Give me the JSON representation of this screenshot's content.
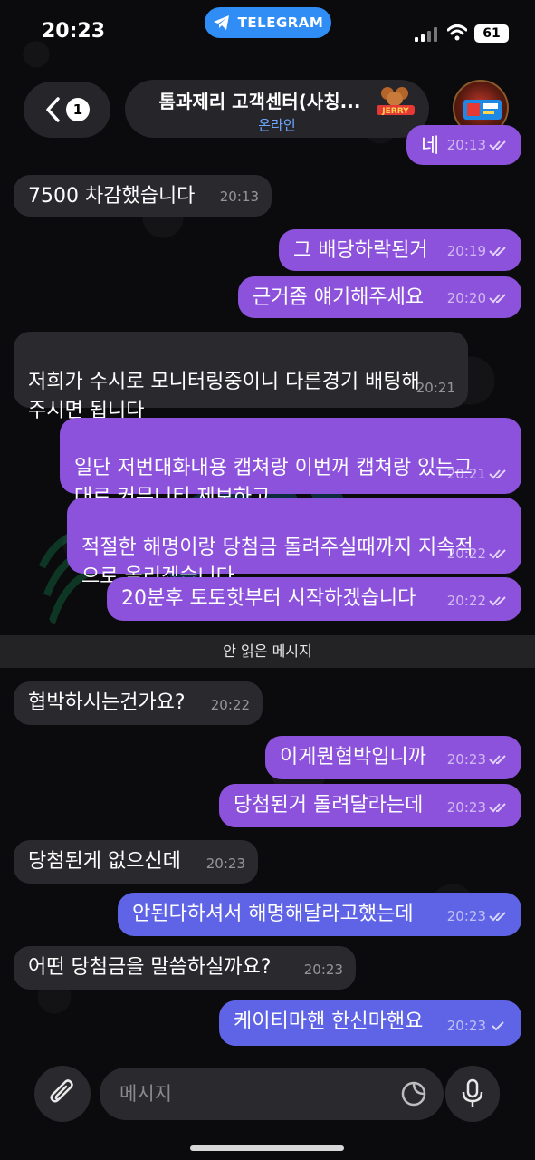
{
  "status_bar": {
    "time": "20:23",
    "app_pill": "TELEGRAM",
    "battery": "61"
  },
  "header": {
    "unread_count": "1",
    "title": "톰과제리 고객센터(사칭...",
    "status": "온라인",
    "logo_text": "JERRY"
  },
  "messages": [
    {
      "side": "out",
      "text": "네",
      "time": "20:13"
    },
    {
      "side": "in",
      "text": "7500 차감했습니다",
      "time": "20:13"
    },
    {
      "side": "out",
      "text": "그 배당하락된거",
      "time": "20:19"
    },
    {
      "side": "out",
      "text": "근거좀 얘기해주세요",
      "time": "20:20"
    },
    {
      "side": "in",
      "text": "저희가 수시로 모니터링중이니 다른경기 배팅해\n주시면 됩니다",
      "time": "20:21"
    },
    {
      "side": "out",
      "text": "일단 저번대화내용 캡쳐랑 이번꺼 캡쳐랑 있는그\n대로 커뮤니티 제보하고",
      "time": "20:21"
    },
    {
      "side": "out",
      "text": "적절한 해명이랑 당첨금 돌려주실때까지 지속적\n으로 올리겠습니다",
      "time": "20:22"
    },
    {
      "side": "out",
      "text": "20분후 토토핫부터 시작하겠습니다",
      "time": "20:22"
    },
    {
      "side": "in",
      "text": "협박하시는건가요?",
      "time": "20:22"
    },
    {
      "side": "out",
      "text": "이게뭔협박입니까",
      "time": "20:23"
    },
    {
      "side": "out",
      "text": "당첨된거 돌려달라는데",
      "time": "20:23"
    },
    {
      "side": "in",
      "text": "당첨된게 없으신데",
      "time": "20:23"
    },
    {
      "side": "out",
      "text": "안된다하셔서 해명해달라고했는데",
      "time": "20:23"
    },
    {
      "side": "in",
      "text": "어떤 당첨금을 말씀하실까요?",
      "time": "20:23"
    },
    {
      "side": "out",
      "text": "케이티마핸 한신마핸요",
      "time": "20:23"
    }
  ],
  "unread_divider": "안 읽은 메시지",
  "composer": {
    "placeholder": "메시지"
  },
  "icons": {
    "back": "chevron-left-icon",
    "attach": "paperclip-icon",
    "sticker": "sticker-icon",
    "mic": "microphone-icon",
    "telegram": "telegram-plane-icon"
  },
  "colors": {
    "outgoing_purple": "#8d52dc",
    "outgoing_blue": "#5f64e6",
    "incoming": "#2a2a2e",
    "online": "#6fa8ff",
    "telegram_pill": "#2f8df5"
  }
}
